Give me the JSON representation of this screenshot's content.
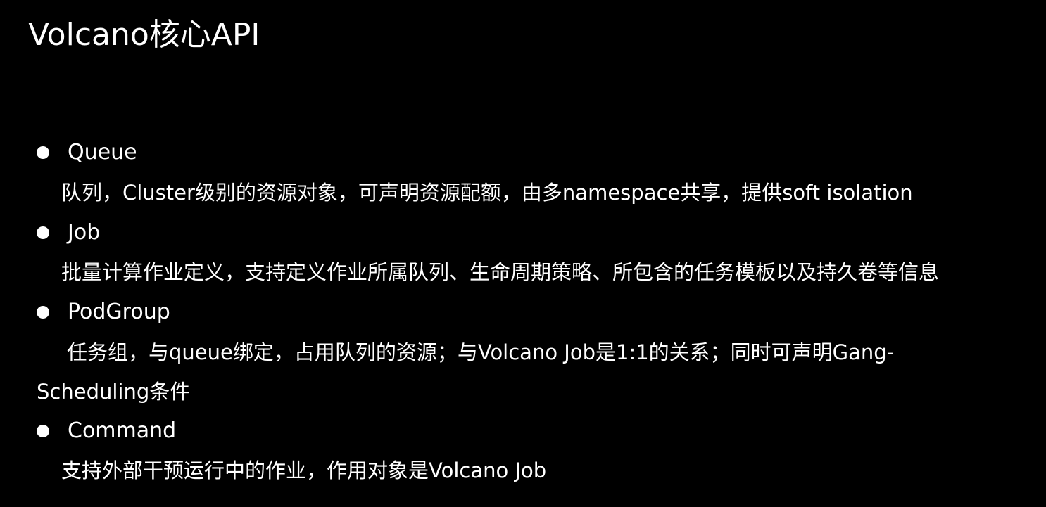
{
  "slide": {
    "title": "Volcano核心API",
    "items": [
      {
        "label": "Queue",
        "description": "队列，Cluster级别的资源对象，可声明资源配额，由多namespace共享，提供soft isolation"
      },
      {
        "label": "Job",
        "description": "批量计算作业定义，支持定义作业所属队列、生命周期策略、所包含的任务模板以及持久卷等信息"
      },
      {
        "label": "PodGroup",
        "description_lines": [
          "任务组，与queue绑定，占用队列的资源；与Volcano Job是1:1的关系；同时可声明Gang-",
          "Scheduling条件"
        ]
      },
      {
        "label": "Command",
        "description": "支持外部干预运行中的作业，作用对象是Volcano Job"
      }
    ]
  }
}
